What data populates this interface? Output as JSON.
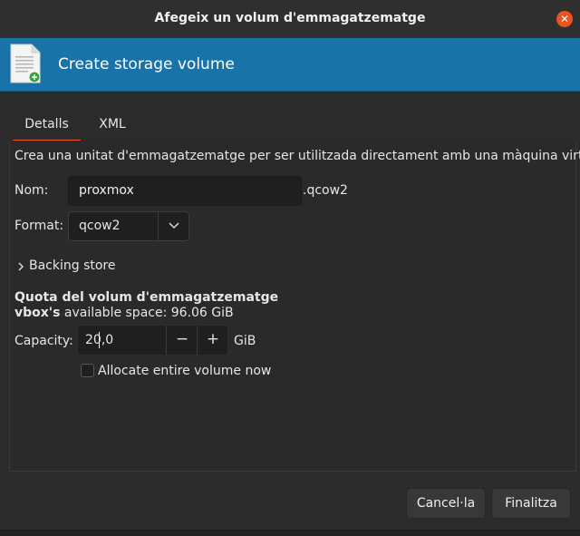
{
  "window": {
    "title": "Afegeix un volum d'emmagatzematge"
  },
  "banner": {
    "title": "Create storage volume"
  },
  "tabs": [
    {
      "label": "Detalls"
    },
    {
      "label": "XML"
    }
  ],
  "details": {
    "description": "Crea una unitat d'emmagatzematge per ser utilitzada directament amb una màquina virtual.",
    "name_label": "Nom:",
    "name_value": "proxmox",
    "name_suffix": ".qcow2",
    "format_label": "Format:",
    "format_value": "qcow2",
    "backing_store_label": "Backing store",
    "quota_heading": "Quota del volum d'emmagatzematge",
    "pool_name": "vbox's",
    "available_space_text": "available space: 96.06 GiB",
    "capacity_label": "Capacity:",
    "capacity_value": "20,0",
    "capacity_unit": "GiB",
    "allocate_label": "Allocate entire volume now",
    "allocate_checked": false
  },
  "buttons": {
    "cancel": "Cancel·la",
    "finish": "Finalitza"
  },
  "icons": {
    "close": "close-icon",
    "document": "new-document-icon",
    "combo_arrow": "chevron-down-icon",
    "expander": "chevron-right-icon",
    "decrement": "minus-icon",
    "increment": "plus-icon"
  },
  "colors": {
    "accent": "#e95420",
    "banner": "#1a73a8",
    "background": "#2b2b2b"
  }
}
